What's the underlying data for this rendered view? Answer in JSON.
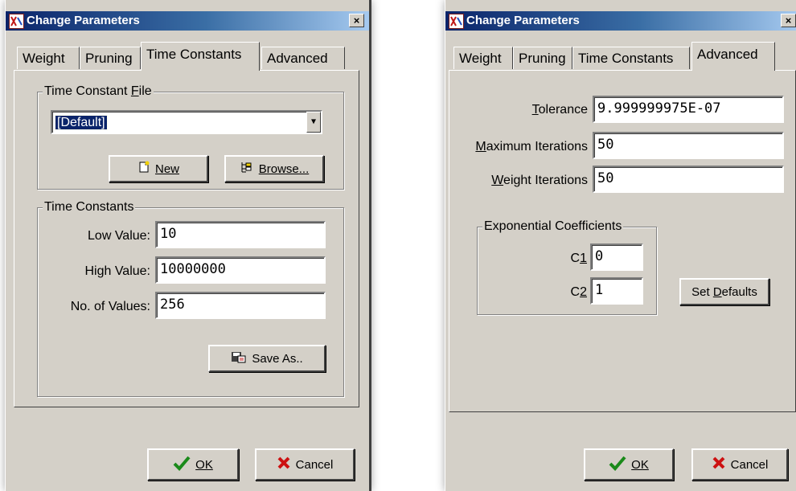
{
  "dialog1": {
    "title": "Change Parameters",
    "close_glyph": "×",
    "tabs": [
      "Weight",
      "Pruning",
      "Time Constants",
      "Advanced"
    ],
    "active_tab": "Time Constants",
    "time_constant_file": {
      "legend": "Time Constant File",
      "combo_value": "[Default]",
      "new_label": "New",
      "browse_label": "Browse..."
    },
    "time_constants": {
      "legend": "Time Constants",
      "low_label": "Low Value:",
      "low_value": "10",
      "high_label": "High Value:",
      "high_value": "10000000",
      "count_label": "No. of Values:",
      "count_value": "256",
      "save_as_label": "Save As.."
    },
    "ok_label": "OK",
    "cancel_label": "Cancel"
  },
  "dialog2": {
    "title": "Change Parameters",
    "close_glyph": "×",
    "tabs": [
      "Weight",
      "Pruning",
      "Time Constants",
      "Advanced"
    ],
    "active_tab": "Advanced",
    "tolerance_label": "Tolerance",
    "tolerance_value": "9.999999975E-07",
    "max_iter_label": "Maximum Iterations",
    "max_iter_value": "50",
    "weight_iter_label": "Weight Iterations",
    "weight_iter_value": "50",
    "exp_coeff": {
      "legend": "Exponential Coefficients",
      "c1_label": "C1",
      "c1_value": "0",
      "c2_label": "C2",
      "c2_value": "1"
    },
    "set_defaults_label": "Set Defaults",
    "ok_label": "OK",
    "cancel_label": "Cancel"
  },
  "icons": {
    "app": "app-icon",
    "new": "new-document-icon",
    "browse": "browse-tree-icon",
    "save_as": "save-as-icon",
    "ok": "checkmark-icon",
    "cancel": "red-x-icon"
  },
  "colors": {
    "titlebar_start": "#0a246a",
    "titlebar_end": "#a6caf0",
    "face": "#d4d0c8",
    "ok_check": "#1a8a1a",
    "cancel_x": "#cc1111"
  }
}
